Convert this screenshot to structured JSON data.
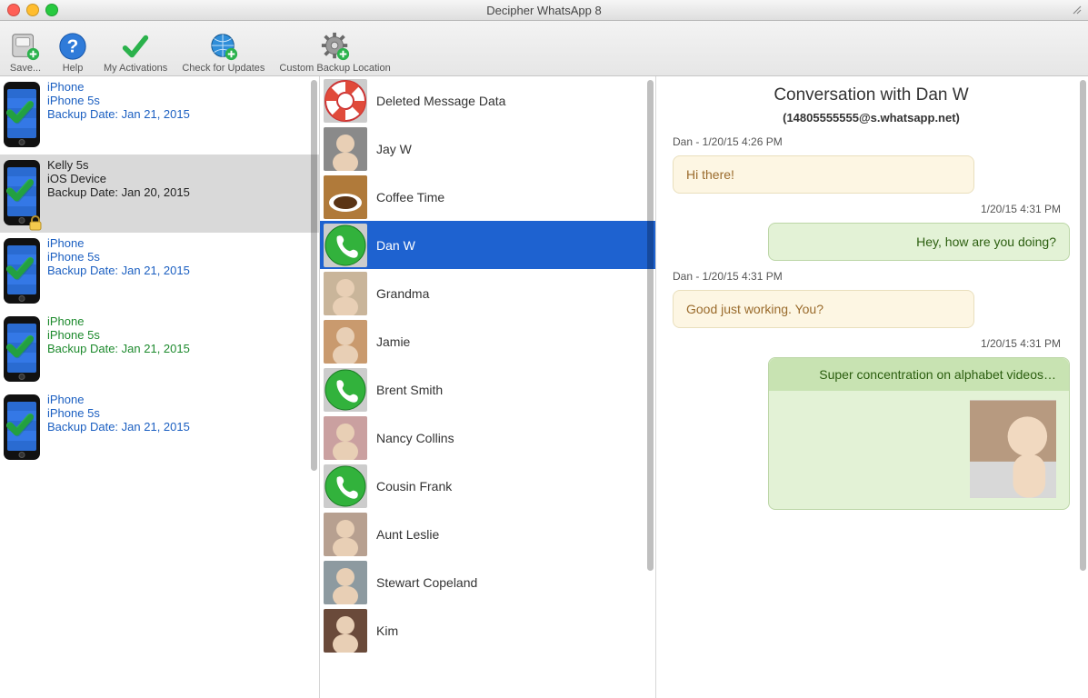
{
  "window": {
    "title": "Decipher WhatsApp 8"
  },
  "toolbar": {
    "save": {
      "label": "Save...",
      "icon": "save-icon"
    },
    "help": {
      "label": "Help",
      "icon": "help-icon"
    },
    "act": {
      "label": "My Activations",
      "icon": "activations-icon"
    },
    "update": {
      "label": "Check for Updates",
      "icon": "update-icon"
    },
    "backup": {
      "label": "Custom Backup Location",
      "icon": "gear-icon"
    }
  },
  "devices": [
    {
      "name": "iPhone",
      "model": "iPhone 5s",
      "backup": "Backup Date: Jan 21, 2015",
      "style": "blue",
      "locked": false
    },
    {
      "name": "Kelly 5s",
      "model": "iOS Device",
      "backup": "Backup Date: Jan 20, 2015",
      "style": "black",
      "locked": true
    },
    {
      "name": "iPhone",
      "model": "iPhone 5s",
      "backup": "Backup Date: Jan 21, 2015",
      "style": "blue",
      "locked": false
    },
    {
      "name": "iPhone",
      "model": "iPhone 5s",
      "backup": "Backup Date: Jan 21, 2015",
      "style": "green",
      "locked": false
    },
    {
      "name": "iPhone",
      "model": "iPhone 5s",
      "backup": "Backup Date: Jan 21, 2015",
      "style": "blue",
      "locked": false
    }
  ],
  "selected_device_index": 1,
  "contacts": [
    {
      "name": "Deleted Message Data",
      "icon": "lifesaver"
    },
    {
      "name": "Jay W",
      "icon": "person1"
    },
    {
      "name": "Coffee Time",
      "icon": "coffee"
    },
    {
      "name": "Dan W",
      "icon": "phone"
    },
    {
      "name": "Grandma",
      "icon": "person2"
    },
    {
      "name": "Jamie",
      "icon": "person3"
    },
    {
      "name": "Brent Smith",
      "icon": "phone"
    },
    {
      "name": "Nancy Collins",
      "icon": "person4"
    },
    {
      "name": "Cousin Frank",
      "icon": "phone"
    },
    {
      "name": "Aunt Leslie",
      "icon": "person5"
    },
    {
      "name": "Stewart Copeland",
      "icon": "person6"
    },
    {
      "name": "Kim",
      "icon": "person7"
    }
  ],
  "selected_contact_index": 3,
  "conversation": {
    "title": "Conversation with Dan W",
    "subtitle": "(14805555555@s.whatsapp.net)",
    "messages": [
      {
        "who": "them",
        "sender": "Dan",
        "ts": "1/20/15 4:26 PM",
        "text": "Hi there!"
      },
      {
        "who": "me",
        "ts": "1/20/15 4:31 PM",
        "text": "Hey, how are you doing?"
      },
      {
        "who": "them",
        "sender": "Dan",
        "ts": "1/20/15 4:31 PM",
        "text": "Good just working. You?"
      },
      {
        "who": "me",
        "ts": "1/20/15 4:31 PM",
        "text": "Super concentration on alphabet videos…",
        "has_media": true
      }
    ]
  }
}
